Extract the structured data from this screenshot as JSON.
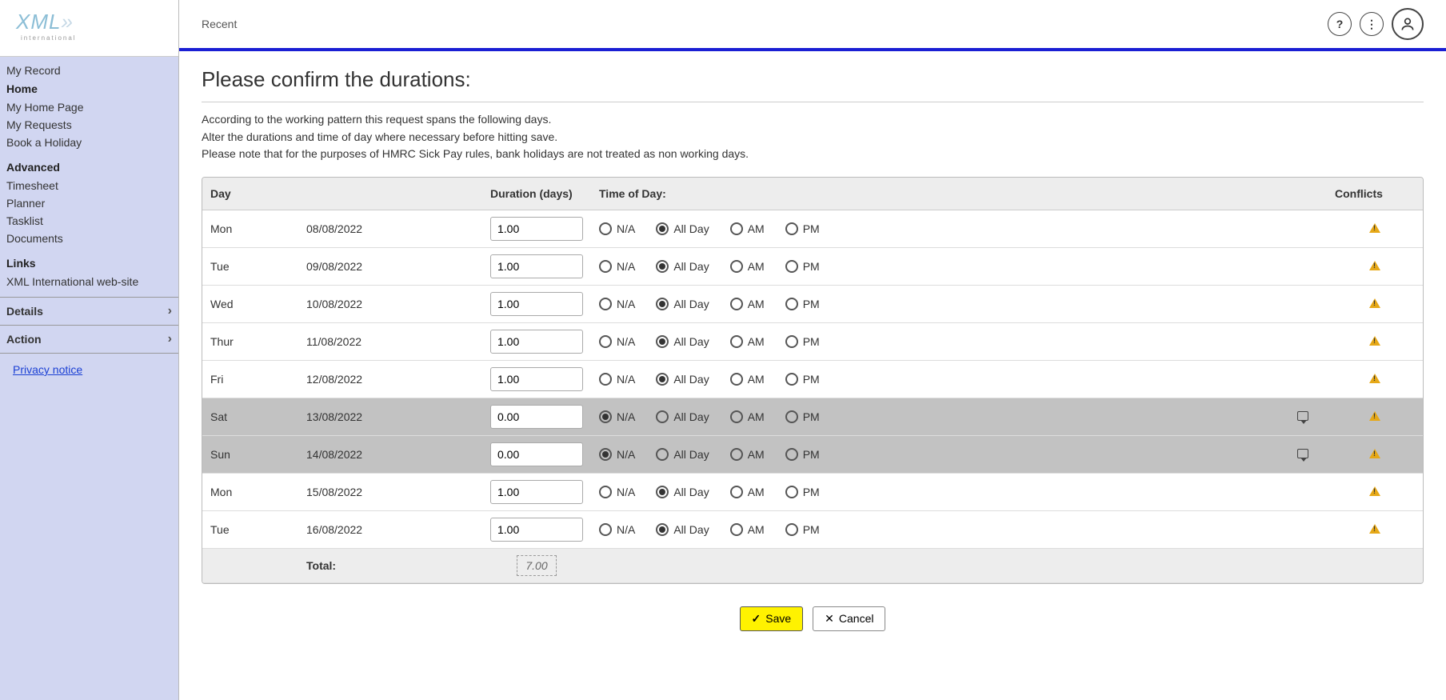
{
  "topbar": {
    "recent": "Recent"
  },
  "sidebar": {
    "my_record": "My Record",
    "home_header": "Home",
    "home_items": [
      "My Home Page",
      "My Requests",
      "Book a Holiday"
    ],
    "adv_header": "Advanced",
    "adv_items": [
      "Timesheet",
      "Planner",
      "Tasklist",
      "Documents"
    ],
    "links_header": "Links",
    "links_items": [
      "XML International web-site"
    ],
    "details": "Details",
    "action": "Action",
    "privacy": "Privacy notice"
  },
  "page": {
    "title": "Please confirm the durations:",
    "note1": "According to the working pattern this request spans the following days.",
    "note2": "Alter the durations and time of day where necessary before hitting save.",
    "note3": "Please note that for the purposes of HMRC Sick Pay rules, bank holidays are not treated as non working days."
  },
  "table": {
    "headers": {
      "day": "Day",
      "duration": "Duration (days)",
      "tod": "Time of Day:",
      "conflicts": "Conflicts"
    },
    "tod_labels": {
      "na": "N/A",
      "allday": "All Day",
      "am": "AM",
      "pm": "PM"
    },
    "rows": [
      {
        "day": "Mon",
        "date": "08/08/2022",
        "duration": "1.00",
        "tod": "allday",
        "weekend": false,
        "comment": false,
        "conflict": true
      },
      {
        "day": "Tue",
        "date": "09/08/2022",
        "duration": "1.00",
        "tod": "allday",
        "weekend": false,
        "comment": false,
        "conflict": true
      },
      {
        "day": "Wed",
        "date": "10/08/2022",
        "duration": "1.00",
        "tod": "allday",
        "weekend": false,
        "comment": false,
        "conflict": true
      },
      {
        "day": "Thur",
        "date": "11/08/2022",
        "duration": "1.00",
        "tod": "allday",
        "weekend": false,
        "comment": false,
        "conflict": true
      },
      {
        "day": "Fri",
        "date": "12/08/2022",
        "duration": "1.00",
        "tod": "allday",
        "weekend": false,
        "comment": false,
        "conflict": true
      },
      {
        "day": "Sat",
        "date": "13/08/2022",
        "duration": "0.00",
        "tod": "na",
        "weekend": true,
        "comment": true,
        "conflict": true
      },
      {
        "day": "Sun",
        "date": "14/08/2022",
        "duration": "0.00",
        "tod": "na",
        "weekend": true,
        "comment": true,
        "conflict": true
      },
      {
        "day": "Mon",
        "date": "15/08/2022",
        "duration": "1.00",
        "tod": "allday",
        "weekend": false,
        "comment": false,
        "conflict": true
      },
      {
        "day": "Tue",
        "date": "16/08/2022",
        "duration": "1.00",
        "tod": "allday",
        "weekend": false,
        "comment": false,
        "conflict": true
      }
    ],
    "total_label": "Total:",
    "total_value": "7.00"
  },
  "buttons": {
    "save": "Save",
    "cancel": "Cancel"
  }
}
